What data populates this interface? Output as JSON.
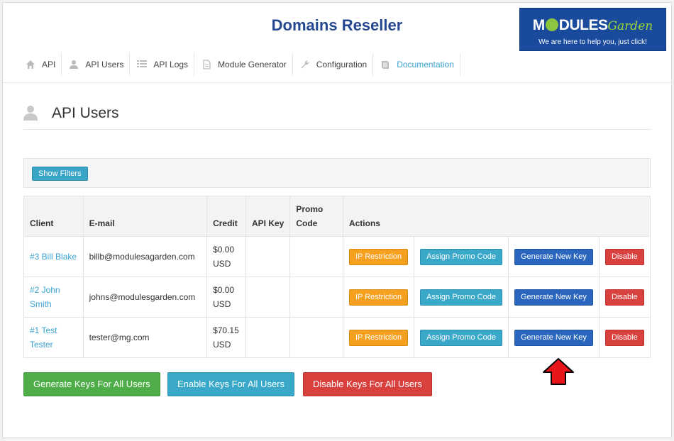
{
  "header": {
    "title": "Domains Reseller",
    "logo": {
      "part1": "M",
      "part2": "DULES",
      "part3": "Garden",
      "tagline": "We are here to help you, just click!"
    }
  },
  "nav": {
    "items": [
      {
        "label": "API",
        "icon": "home-icon"
      },
      {
        "label": "API Users",
        "icon": "user-icon"
      },
      {
        "label": "API Logs",
        "icon": "list-icon"
      },
      {
        "label": "Module Generator",
        "icon": "file-icon"
      },
      {
        "label": "Configuration",
        "icon": "wrench-icon"
      },
      {
        "label": "Documentation",
        "icon": "book-icon"
      }
    ]
  },
  "page": {
    "title": "API Users",
    "show_filters_label": "Show Filters"
  },
  "table": {
    "headers": {
      "client": "Client",
      "email": "E-mail",
      "credit": "Credit",
      "api_key": "API Key",
      "promo_line1": "Promo",
      "promo_line2": "Code",
      "actions": "Actions"
    },
    "rows": [
      {
        "client_line1": "#3 Bill Blake",
        "client_line2": "",
        "email": "billb@modulesagarden.com",
        "credit_line1": "$0.00",
        "credit_line2": "USD",
        "api_key": "",
        "promo": ""
      },
      {
        "client_line1": "#2 John",
        "client_line2": "Smith",
        "email": "johns@modulesgarden.com",
        "credit_line1": "$0.00",
        "credit_line2": "USD",
        "api_key": "",
        "promo": ""
      },
      {
        "client_line1": "#1 Test",
        "client_line2": "Tester",
        "email": "tester@mg.com",
        "credit_line1": "$70.15",
        "credit_line2": "USD",
        "api_key": "",
        "promo": ""
      }
    ],
    "actions": {
      "ip_restriction": "IP Restriction",
      "assign_promo": "Assign Promo Code",
      "generate_key": "Generate New Key",
      "disable": "Disable"
    }
  },
  "bulk": {
    "generate_all": "Generate Keys For All Users",
    "enable_all": "Enable Keys For All Users",
    "disable_all": "Disable Keys For All Users"
  },
  "colors": {
    "title": "#24478f",
    "link": "#3ba2d4",
    "orange": "#f5a01f",
    "teal": "#3aa8c8",
    "blue": "#2b66be",
    "red": "#d9413f",
    "green": "#4fae49",
    "arrow": "#e8151b"
  }
}
